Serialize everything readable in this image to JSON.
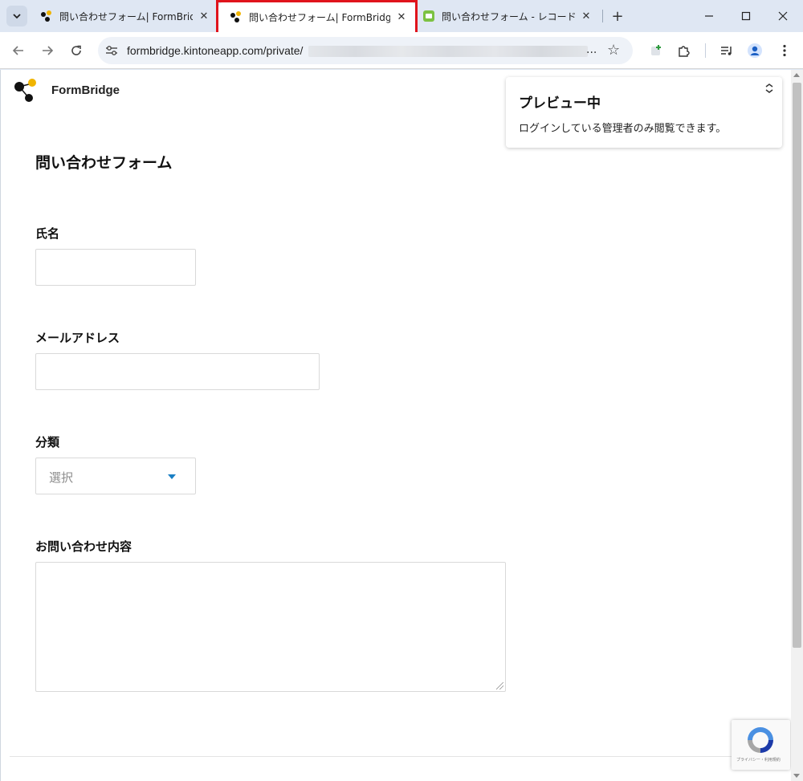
{
  "browser": {
    "tabs": [
      {
        "title": "問い合わせフォーム| FormBridge",
        "active": false
      },
      {
        "title": "問い合わせフォーム| FormBridge",
        "active": true
      },
      {
        "title": "問い合わせフォーム - レコードの一覧",
        "active": false
      }
    ],
    "url": "formbridge.kintoneapp.com/private/",
    "url_ellipsis": "...",
    "highlight_color": "#e0141c"
  },
  "page": {
    "brand": "FormBridge",
    "preview": {
      "title": "プレビュー中",
      "message": "ログインしている管理者のみ閲覧できます。"
    },
    "form": {
      "title": "問い合わせフォーム",
      "fields": {
        "name_label": "氏名",
        "email_label": "メールアドレス",
        "category_label": "分類",
        "category_placeholder": "選択",
        "inquiry_label": "お問い合わせ内容"
      }
    },
    "recaptcha_text": "プライバシー・利用規約"
  },
  "icons": {
    "tab_favicon": "formbridge-logo-icon",
    "kintone_favicon": "kintone-icon",
    "accent_blue": "#1a7fc4"
  }
}
